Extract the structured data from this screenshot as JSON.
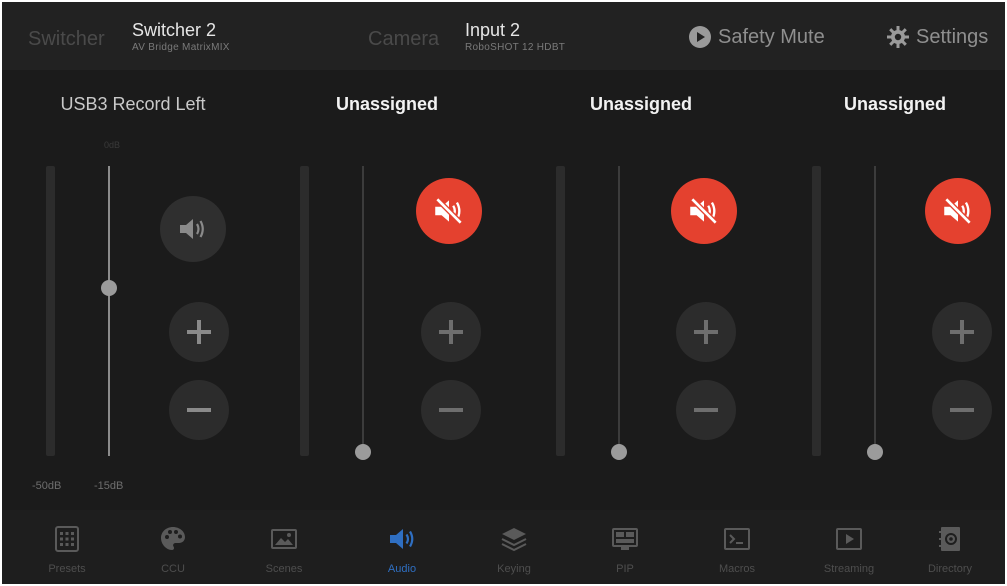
{
  "header": {
    "switcher_label": "Switcher",
    "switcher_name": "Switcher 2",
    "switcher_model": "AV Bridge MatrixMIX",
    "camera_label": "Camera",
    "camera_name": "Input 2",
    "camera_model": "RoboSHOT 12 HDBT",
    "safety_mute_label": "Safety Mute",
    "settings_label": "Settings"
  },
  "channels": [
    {
      "title": "USB3 Record Left",
      "scale_mark": "0dB",
      "muted": false,
      "level": 0.58,
      "meter_min": "-50dB",
      "meter_max": "-15dB"
    },
    {
      "title": "Unassigned",
      "muted": true,
      "level": 0.0
    },
    {
      "title": "Unassigned",
      "muted": true,
      "level": 0.0
    },
    {
      "title": "Unassigned",
      "muted": true,
      "level": 0.0
    }
  ],
  "nav": [
    {
      "label": "Presets",
      "icon": "grid-icon",
      "active": false
    },
    {
      "label": "CCU",
      "icon": "palette-icon",
      "active": false
    },
    {
      "label": "Scenes",
      "icon": "image-icon",
      "active": false
    },
    {
      "label": "Audio",
      "icon": "speaker-icon",
      "active": true
    },
    {
      "label": "Keying",
      "icon": "layers-icon",
      "active": false
    },
    {
      "label": "PIP",
      "icon": "pip-icon",
      "active": false
    },
    {
      "label": "Macros",
      "icon": "terminal-icon",
      "active": false
    },
    {
      "label": "Streaming",
      "icon": "play-box-icon",
      "active": false
    },
    {
      "label": "Directory",
      "icon": "address-book-icon",
      "active": false
    }
  ],
  "colors": {
    "mute_active": "#e4412f",
    "nav_active": "#2f6fc2"
  }
}
